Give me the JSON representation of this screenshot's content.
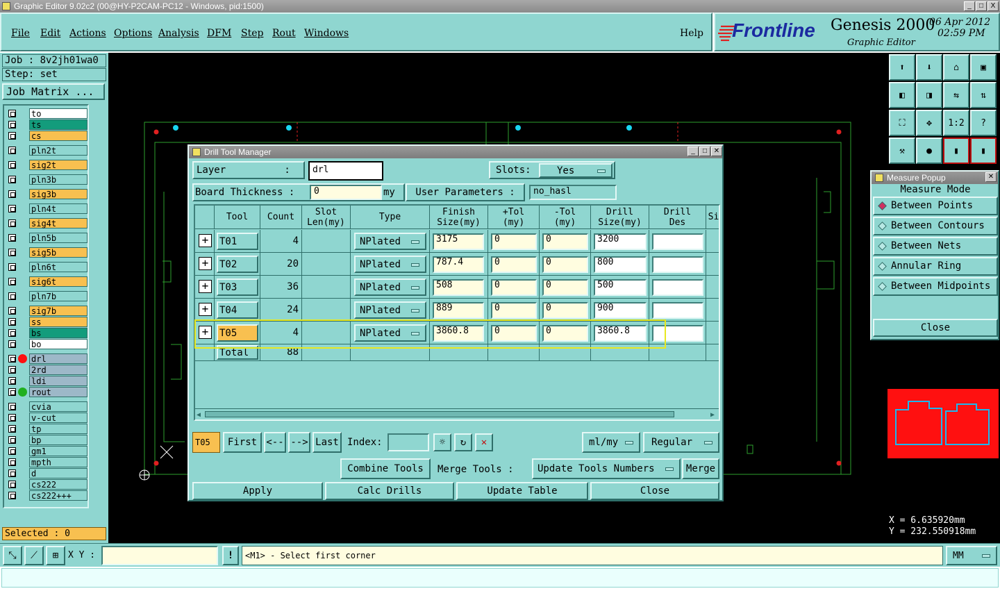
{
  "window": {
    "title": "Graphic Editor 9.02c2 (00@HY-P2CAM-PC12 - Windows, pid:1500)",
    "controls": [
      "_",
      "□",
      "X"
    ]
  },
  "menubar": {
    "items": [
      "File",
      "Edit",
      "Actions",
      "Options",
      "Analysis",
      "DFM",
      "Step",
      "Rout",
      "Windows"
    ],
    "help": "Help"
  },
  "brand": {
    "logo": "Frontline",
    "product": "Genesis 2000",
    "subtitle": "Graphic Editor",
    "date": "06 Apr 2012",
    "time": "02:59 PM"
  },
  "left_panel": {
    "job": "Job : 8v2jh01wa0",
    "step": "Step: set",
    "job_matrix": "Job Matrix ...",
    "layers": [
      {
        "name": "to",
        "color": "#ffffff"
      },
      {
        "name": "ts",
        "color": "#139c7c"
      },
      {
        "name": "cs",
        "color": "#f8c050"
      },
      {
        "name": "pln2t",
        "color": "#8fd6d0"
      },
      {
        "name": "sig2t",
        "color": "#f8c050"
      },
      {
        "name": "pln3b",
        "color": "#8fd6d0"
      },
      {
        "name": "sig3b",
        "color": "#f8c050"
      },
      {
        "name": "pln4t",
        "color": "#8fd6d0"
      },
      {
        "name": "sig4t",
        "color": "#f8c050"
      },
      {
        "name": "pln5b",
        "color": "#8fd6d0"
      },
      {
        "name": "sig5b",
        "color": "#f8c050"
      },
      {
        "name": "pln6t",
        "color": "#8fd6d0"
      },
      {
        "name": "sig6t",
        "color": "#f8c050"
      },
      {
        "name": "pln7b",
        "color": "#8fd6d0"
      },
      {
        "name": "sig7b",
        "color": "#f8c050"
      },
      {
        "name": "ss",
        "color": "#f8c050"
      },
      {
        "name": "bs",
        "color": "#139c7c"
      },
      {
        "name": "bo",
        "color": "#ffffff"
      },
      {
        "name": "drl",
        "color": "#9db8c8"
      },
      {
        "name": "2rd",
        "color": "#9db8c8"
      },
      {
        "name": "ldi",
        "color": "#9db8c8"
      },
      {
        "name": "rout",
        "color": "#9db8c8"
      },
      {
        "name": "cvia",
        "color": "#8fd6d0"
      },
      {
        "name": "v-cut",
        "color": "#8fd6d0"
      },
      {
        "name": "tp",
        "color": "#8fd6d0"
      },
      {
        "name": "bp",
        "color": "#8fd6d0"
      },
      {
        "name": "gm1",
        "color": "#8fd6d0"
      },
      {
        "name": "mpth",
        "color": "#8fd6d0"
      },
      {
        "name": "d",
        "color": "#8fd6d0"
      },
      {
        "name": "cs222",
        "color": "#8fd6d0"
      },
      {
        "name": "cs222+++",
        "color": "#8fd6d0"
      }
    ],
    "selected": "Selected : 0"
  },
  "drill_dialog": {
    "title": "Drill Tool Manager",
    "layer_label": "Layer          :",
    "layer_value": "drl",
    "slots_label": "Slots:",
    "slots_value": "Yes",
    "board_thickness_label": "Board Thickness :",
    "board_thickness_value": "0",
    "unit": "my",
    "user_params_label": "User Parameters :",
    "user_params_value": "no_hasl",
    "columns": [
      "Tool",
      "Count",
      "Slot\nLen(my)",
      "Type",
      "Finish\nSize(my)",
      "+Tol\n(my)",
      "-Tol\n(my)",
      "Drill\nSize(my)",
      "Drill\nDes",
      "Si"
    ],
    "rows": [
      {
        "tool": "T01",
        "count": "4",
        "type": "NPlated",
        "finish": "3175",
        "ptol": "0",
        "mtol": "0",
        "drill": "3200",
        "des": ""
      },
      {
        "tool": "T02",
        "count": "20",
        "type": "NPlated",
        "finish": "787.4",
        "ptol": "0",
        "mtol": "0",
        "drill": "800",
        "des": ""
      },
      {
        "tool": "T03",
        "count": "36",
        "type": "NPlated",
        "finish": "508",
        "ptol": "0",
        "mtol": "0",
        "drill": "500",
        "des": ""
      },
      {
        "tool": "T04",
        "count": "24",
        "type": "NPlated",
        "finish": "889",
        "ptol": "0",
        "mtol": "0",
        "drill": "900",
        "des": ""
      },
      {
        "tool": "T05",
        "count": "4",
        "type": "NPlated",
        "finish": "3860.8",
        "ptol": "0",
        "mtol": "0",
        "drill": "3860.8",
        "des": ""
      }
    ],
    "total_label": "Total",
    "total_count": "88",
    "nav": {
      "current": "T05",
      "first": "First",
      "prev": "<--",
      "next": "-->",
      "last": "Last",
      "index_label": "Index:",
      "index_value": "",
      "units": "ml/my",
      "mode": "Regular"
    },
    "combine_tools": "Combine Tools",
    "merge_tools_label": "Merge Tools :",
    "update_tools_numbers": "Update Tools Numbers",
    "merge": "Merge",
    "apply": "Apply",
    "calc_drills": "Calc Drills",
    "update_table": "Update Table",
    "close": "Close"
  },
  "measure_popup": {
    "title": "Measure Popup",
    "mode_label": "Measure Mode",
    "options": [
      "Between Points",
      "Between Contours",
      "Between Nets",
      "Annular Ring",
      "Between Midpoints"
    ],
    "selected_index": 0,
    "close": "Close"
  },
  "coords": {
    "x": "X =  6.635920mm",
    "y": "Y = 232.550918mm"
  },
  "bottom": {
    "xy_label": "X Y :",
    "xy_value": "",
    "prompt": "<M1> - Select first corner",
    "units": "MM"
  },
  "colors": {
    "panel_teal": "#8fd6d0",
    "highlight_yellow": "#e8e820",
    "drill_red": "#ff0000",
    "pad_cyan": "#19d6f0"
  }
}
